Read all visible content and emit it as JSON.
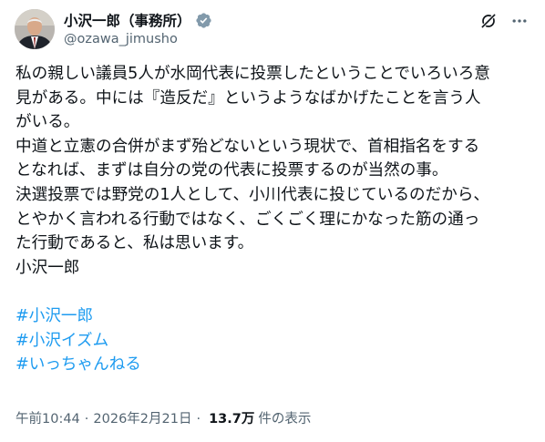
{
  "author": {
    "display_name": "小沢一郎（事務所）",
    "handle": "@ozawa_jimusho"
  },
  "icons": {
    "verified": "verified-badge-icon",
    "grok": "grok-icon",
    "more": "more-options-icon"
  },
  "colors": {
    "text": "#0f1419",
    "secondary": "#536471",
    "link": "#1d9bf0",
    "badge": "#829aab"
  },
  "post": {
    "lines": [
      "私の親しい議員5人が水岡代表に投票したということでいろいろ意",
      "見がある。中には『造反だ』というようなばかげたことを言う人",
      "がいる。",
      "中道と立憲の合併がまず殆どないという現状で、首相指名をする",
      "となれば、まずは自分の党の代表に投票するのが当然の事。",
      "決選投票では野党の1人として、小川代表に投じているのだから、",
      "とやかく言われる行動ではなく、ごくごく理にかなった筋の通っ",
      "た行動であると、私は思います。",
      "小沢一郎"
    ],
    "hashtags": [
      "#小沢一郎",
      "#小沢イズム",
      "#いっちゃんねる"
    ]
  },
  "meta": {
    "time": "午前10:44",
    "separator": "·",
    "date": "2026年2月21日",
    "views_count": "13.7万",
    "views_label": "件の表示"
  }
}
